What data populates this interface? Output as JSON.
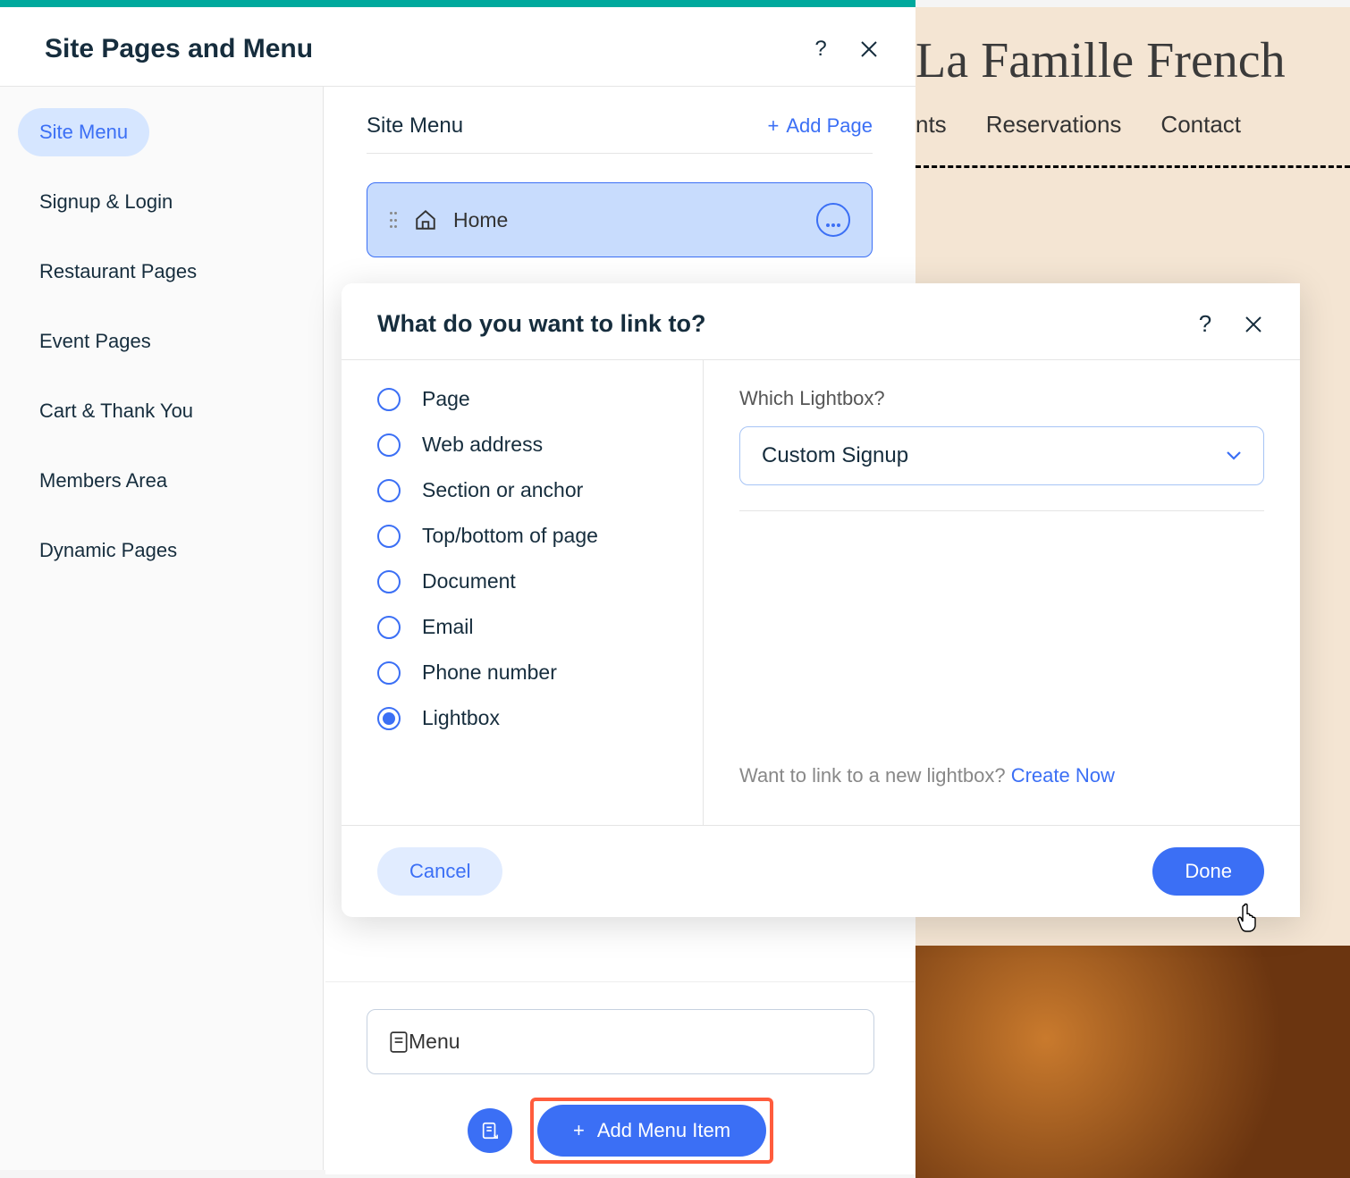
{
  "panel": {
    "title": "Site Pages and Menu"
  },
  "sidebar": {
    "items": [
      {
        "label": "Site Menu",
        "active": true
      },
      {
        "label": "Signup & Login"
      },
      {
        "label": "Restaurant Pages"
      },
      {
        "label": "Event Pages"
      },
      {
        "label": "Cart & Thank You"
      },
      {
        "label": "Members Area"
      },
      {
        "label": "Dynamic Pages"
      }
    ]
  },
  "content": {
    "section_title": "Site Menu",
    "add_page_label": "Add Page",
    "pages": [
      {
        "label": "Home",
        "icon": "home",
        "selected": true
      }
    ],
    "menu_item_label": "Menu",
    "add_menu_item_label": "Add Menu Item"
  },
  "modal": {
    "title": "What do you want to link to?",
    "options": [
      "Page",
      "Web address",
      "Section or anchor",
      "Top/bottom of page",
      "Document",
      "Email",
      "Phone number",
      "Lightbox"
    ],
    "selected_index": 7,
    "lightbox_label": "Which Lightbox?",
    "lightbox_value": "Custom Signup",
    "create_prompt": "Want to link to a new lightbox? ",
    "create_link": "Create Now",
    "cancel_label": "Cancel",
    "done_label": "Done"
  },
  "site_preview": {
    "title": "La Famille French",
    "nav": [
      "nts",
      "Reservations",
      "Contact"
    ]
  }
}
